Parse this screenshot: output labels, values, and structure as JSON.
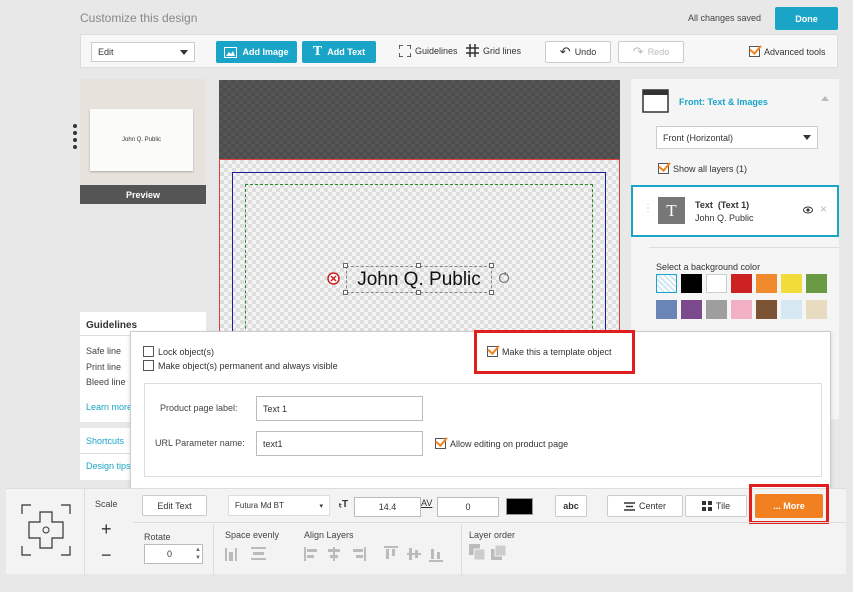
{
  "header": {
    "title": "Customize this design",
    "status": "All changes saved",
    "done_label": "Done"
  },
  "toolbar": {
    "mode_value": "Edit",
    "add_image": "Add Image",
    "add_text": "Add Text",
    "guidelines": "Guidelines",
    "grid_lines": "Grid lines",
    "undo": "Undo",
    "redo": "Redo",
    "advanced_tools": "Advanced tools"
  },
  "preview": {
    "card_text": "John Q. Public",
    "label": "Preview"
  },
  "canvas": {
    "text": "John Q. Public"
  },
  "right_panel": {
    "side_title": "Front: Text & Images",
    "side_select": "Front (Horizontal)",
    "show_layers": "Show all layers (1)",
    "layer_name": "Text  (Text 1)",
    "layer_value": "John Q. Public",
    "bg_label": "Select a background color",
    "colors": [
      "transparent",
      "#000000",
      "#ffffff",
      "#cc2222",
      "#f08a2c",
      "#f2dc3a",
      "#6a9a44",
      "#6a86b8",
      "#7a4a8c",
      "#9e9e9e",
      "#f2b0c4",
      "#7a5434",
      "#d6e8f2",
      "#e8dcc0"
    ]
  },
  "guidelines": {
    "title": "Guidelines",
    "safe": "Safe line",
    "print": "Print line",
    "bleed": "Bleed line",
    "learn_more": "Learn more"
  },
  "links": {
    "shortcuts": "Shortcuts",
    "design_tips": "Design tips"
  },
  "popup": {
    "lock": "Lock object(s)",
    "permanent": "Make object(s) permanent and always visible",
    "template": "Make this a template object",
    "product_label": "Product page label:",
    "product_value": "Text 1",
    "url_label": "URL Parameter name:",
    "url_value": "text1",
    "allow_editing": "Allow editing on product page"
  },
  "bottom": {
    "scale": "Scale",
    "plus": "+",
    "minus": "−",
    "edit_text": "Edit Text",
    "font": "Futura Md BT",
    "font_size": "14.4",
    "spacing": "0",
    "abc": "abc",
    "center": "Center",
    "tile": "Tile",
    "more": "... More",
    "rotate": "Rotate",
    "rotate_value": "0",
    "space_evenly": "Space evenly",
    "align_layers": "Align Layers",
    "layer_order": "Layer order"
  }
}
